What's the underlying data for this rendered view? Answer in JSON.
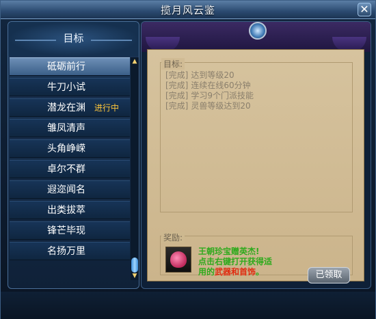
{
  "window": {
    "title": "揽月风云鉴",
    "close_label": "✕"
  },
  "left": {
    "header": "目标",
    "items": [
      {
        "label": "砥砺前行",
        "status": ""
      },
      {
        "label": "牛刀小试",
        "status": ""
      },
      {
        "label": "潜龙在渊",
        "status": "进行中"
      },
      {
        "label": "雏凤清声",
        "status": ""
      },
      {
        "label": "头角峥嵘",
        "status": ""
      },
      {
        "label": "卓尔不群",
        "status": ""
      },
      {
        "label": "遐迩闻名",
        "status": ""
      },
      {
        "label": "出类拔萃",
        "status": ""
      },
      {
        "label": "锋芒毕现",
        "status": ""
      },
      {
        "label": "名扬万里",
        "status": ""
      }
    ],
    "selected_index": 0,
    "scroll_up": "▲",
    "scroll_down": "▼"
  },
  "right": {
    "goals_label": "目标:",
    "goals": [
      {
        "tag": "[完成]",
        "text": "达到等级20"
      },
      {
        "tag": "[完成]",
        "text": "连续在线60分钟"
      },
      {
        "tag": "[完成]",
        "text": "学习9个门派技能"
      },
      {
        "tag": "[完成]",
        "text": "灵兽等级达到20"
      }
    ],
    "reward_label": "奖励:",
    "reward_text": {
      "line1": "王朝珍宝赠英杰!",
      "line2": "点击右键打开获得适",
      "line3_a": "用的",
      "line3_b": "武器和首饰",
      "line3_c": "。"
    },
    "claim_button": "已领取"
  },
  "colors": {
    "selected_item": "#5a7ea8",
    "in_progress": "#ffc63a",
    "reward_green": "#2faa1d",
    "reward_red": "#e02b10"
  }
}
